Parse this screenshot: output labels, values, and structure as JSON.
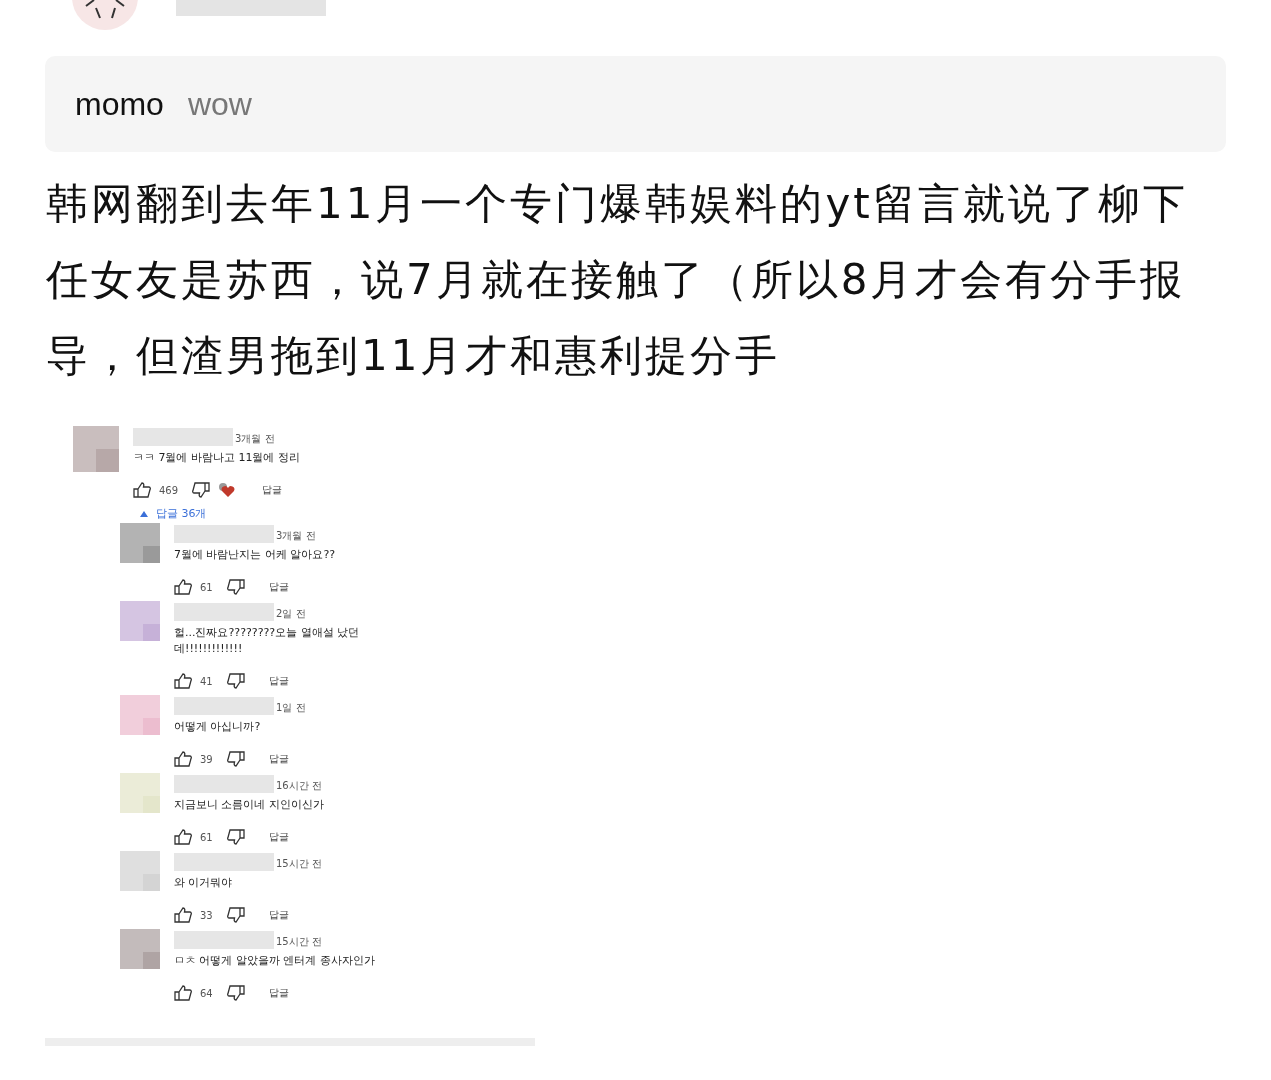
{
  "quote": {
    "user": "momo",
    "text": "wow"
  },
  "post": {
    "text": "韩网翻到去年11月一个专门爆韩娱料的yt留言就说了柳下任女友是苏西，说7月就在接触了（所以8月才会有分手报导，但渣男拖到11月才和惠利提分手"
  },
  "comments": [
    {
      "kind": "top",
      "color": "#b8a8a8",
      "time": "3개월 전",
      "text": "ㅋㅋ 7월에 바람나고 11월에 정리",
      "likes": "469",
      "hearted": true,
      "reply": "답글",
      "replies_toggle": "답글 36개"
    },
    {
      "kind": "reply",
      "color": "#9a9a9a",
      "time": "3개월 전",
      "text": "7월에 바람난지는 어케 알아요??",
      "likes": "61",
      "hearted": false,
      "reply": "답글"
    },
    {
      "kind": "reply",
      "color": "#c8b0dc",
      "time": "2일 전",
      "text": "헐...진짜요????????오늘 열애설 났던데!!!!!!!!!!!!!",
      "likes": "41",
      "hearted": false,
      "reply": "답글"
    },
    {
      "kind": "reply",
      "color": "#f0bcd0",
      "time": "1일 전",
      "text": "어떻게 아십니까?",
      "likes": "39",
      "hearted": false,
      "reply": "답글"
    },
    {
      "kind": "reply",
      "color": "#e4e6c8",
      "time": "16시간 전",
      "text": "지금보니 소름이네 지인이신가",
      "likes": "61",
      "hearted": false,
      "reply": "답글"
    },
    {
      "kind": "reply",
      "color": "#d4d4d4",
      "time": "15시간 전",
      "text": "와 이거뭐야",
      "likes": "33",
      "hearted": false,
      "reply": "답글"
    },
    {
      "kind": "reply",
      "color": "#b0a4a4",
      "time": "15시간 전",
      "text": "ㅁㅊ 어떻게 알았을까 엔터계 종사자인가",
      "likes": "64",
      "hearted": false,
      "reply": "답글"
    }
  ]
}
